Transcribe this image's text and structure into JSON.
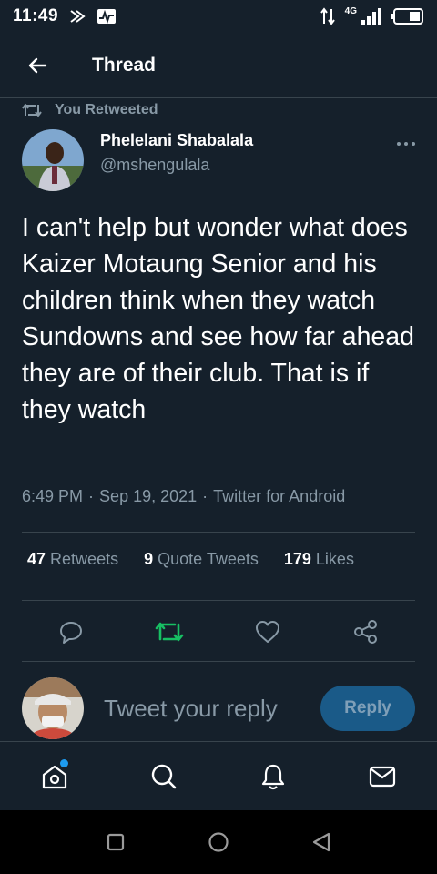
{
  "status_bar": {
    "time": "11:49",
    "network_label": "4G"
  },
  "header": {
    "title": "Thread"
  },
  "retweet_indicator": {
    "label": "You Retweeted"
  },
  "tweet": {
    "author_name": "Phelelani Shabalala",
    "author_handle": "@mshengulala",
    "text": "I can't help but wonder what does Kaizer Motaung Senior and his children think when they watch Sundowns and see how far ahead they are of their club. That is if they watch",
    "time": "6:49 PM",
    "date": "Sep 19, 2021",
    "source": "Twitter for Android",
    "separator": "·"
  },
  "stats": {
    "retweets_count": "47",
    "retweets_label": "Retweets",
    "quote_count": "9",
    "quote_label": "Quote Tweets",
    "likes_count": "179",
    "likes_label": "Likes"
  },
  "reply_composer": {
    "placeholder": "Tweet your reply",
    "button_label": "Reply"
  },
  "icons": {
    "back": "arrow-left-icon",
    "retweet_indicator": "retweet-icon",
    "more": "more-horizontal-icon",
    "reply": "comment-icon",
    "retweet": "retweet-icon",
    "like": "heart-icon",
    "share": "share-icon",
    "home": "home-icon",
    "search": "search-icon",
    "notifications": "bell-icon",
    "messages": "mail-icon"
  },
  "colors": {
    "background": "#15202b",
    "secondary_text": "#8899a6",
    "retweet_active": "#17bf63",
    "accent": "#1d9bf0",
    "reply_button_disabled": "#1a5a88"
  }
}
